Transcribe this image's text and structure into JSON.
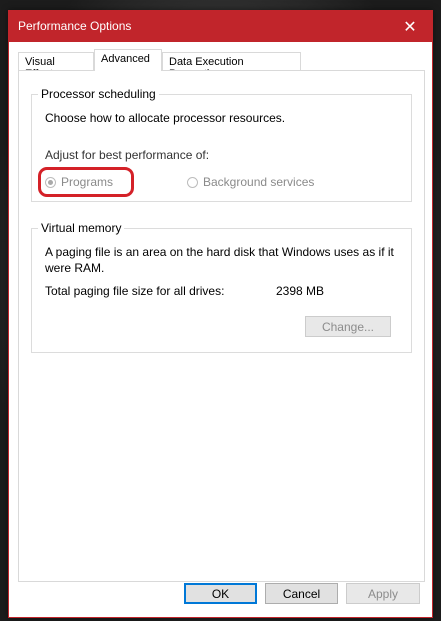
{
  "window": {
    "title": "Performance Options",
    "close_glyph": "✕"
  },
  "tabs": [
    {
      "label": "Visual Effects"
    },
    {
      "label": "Advanced"
    },
    {
      "label": "Data Execution Prevention"
    }
  ],
  "processor": {
    "title": "Processor scheduling",
    "description": "Choose how to allocate processor resources.",
    "adjust_label": "Adjust for best performance of:",
    "option_programs": "Programs",
    "option_background": "Background services",
    "selected": "Programs"
  },
  "virtual_memory": {
    "title": "Virtual memory",
    "description_line1": "A paging file is an area on the hard disk that Windows uses as if it",
    "description_line2": "were RAM.",
    "total_label": "Total paging file size for all drives:",
    "total_value": "2398 MB",
    "change_button": "Change..."
  },
  "footer": {
    "ok": "OK",
    "cancel": "Cancel",
    "apply": "Apply"
  },
  "colors": {
    "titlebar": "#c1252b",
    "highlight": "#d42128",
    "default_button_border": "#0078d7"
  }
}
